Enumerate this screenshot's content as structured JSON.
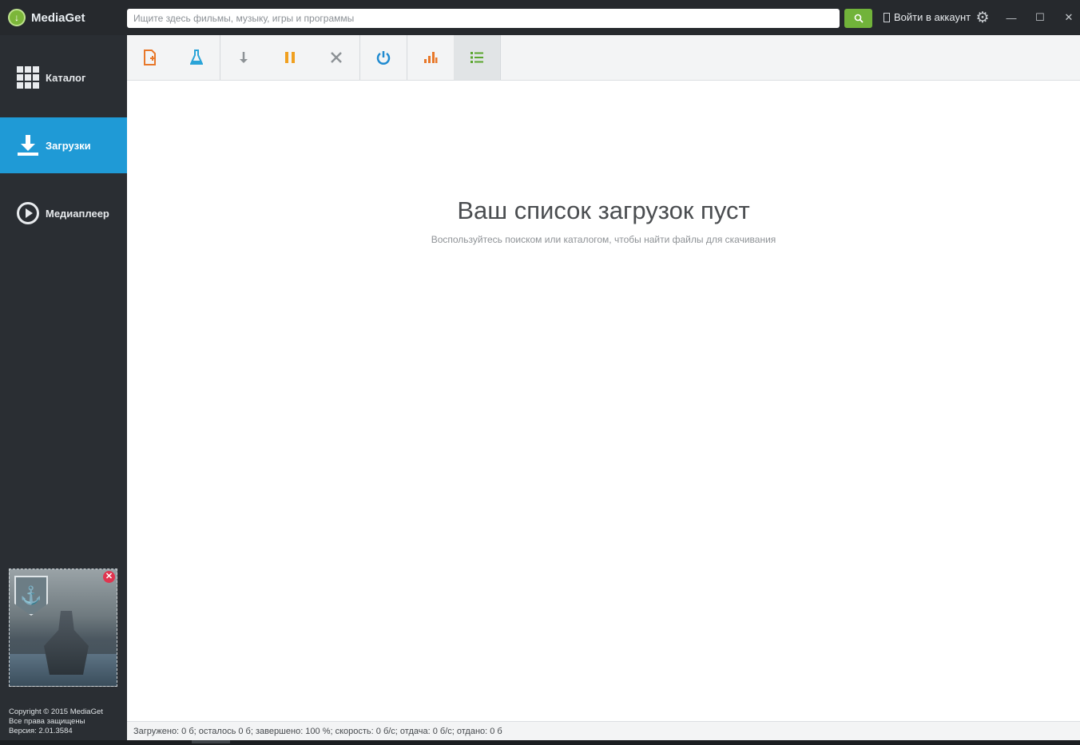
{
  "app": {
    "title": "MediaGet",
    "logo_icon": "download-arrow-icon"
  },
  "search": {
    "placeholder": "Ищите здесь фильмы, музыку, игры и программы",
    "value": "",
    "button_icon": "search-icon"
  },
  "header": {
    "login_label": "Войти в аккаунт",
    "minimize": "—",
    "maximize": "☐",
    "close": "✕"
  },
  "sidebar": {
    "items": [
      {
        "label": "Каталог",
        "icon": "grid-icon",
        "active": false
      },
      {
        "label": "Загрузки",
        "icon": "download-icon",
        "active": true
      },
      {
        "label": "Медиаплеер",
        "icon": "play-icon",
        "active": false
      }
    ],
    "ad": {
      "emblem": "⚓",
      "close": "✕"
    },
    "copyright": {
      "line1": "Copyright © 2015 MediaGet",
      "line2": "Все права защищены",
      "line3": "Версия: 2.01.3584"
    }
  },
  "toolbar": {
    "buttons": [
      {
        "name": "add-file",
        "glyph": "▯",
        "color": "#e8782a"
      },
      {
        "name": "flask",
        "glyph": "⚗",
        "color": "#2aa4d8"
      },
      {
        "name": "download",
        "glyph": "↓",
        "color": "#8d9296"
      },
      {
        "name": "pause",
        "glyph": "❚❚",
        "color": "#f0a020"
      },
      {
        "name": "delete",
        "glyph": "✕",
        "color": "#8d9296"
      },
      {
        "name": "power",
        "glyph": "⏻",
        "color": "#1f8ad0"
      },
      {
        "name": "stats",
        "glyph": "▂▅▇",
        "color": "#e8782a"
      },
      {
        "name": "list",
        "glyph": "☰",
        "color": "#5aa62e"
      }
    ]
  },
  "main": {
    "empty_title": "Ваш список загрузок пуст",
    "empty_subtitle": "Воспользуйтесь поиском или каталогом, чтобы найти файлы для скачивания"
  },
  "statusbar": {
    "text": "Загружено: 0 б; осталось 0 б; завершено: 100 %; скорость: 0 б/с; отдача: 0 б/с; отдано: 0 б"
  },
  "colors": {
    "accent": "#1f9ad6",
    "search_button": "#71b33a",
    "sidebar": "#2a2e33"
  }
}
